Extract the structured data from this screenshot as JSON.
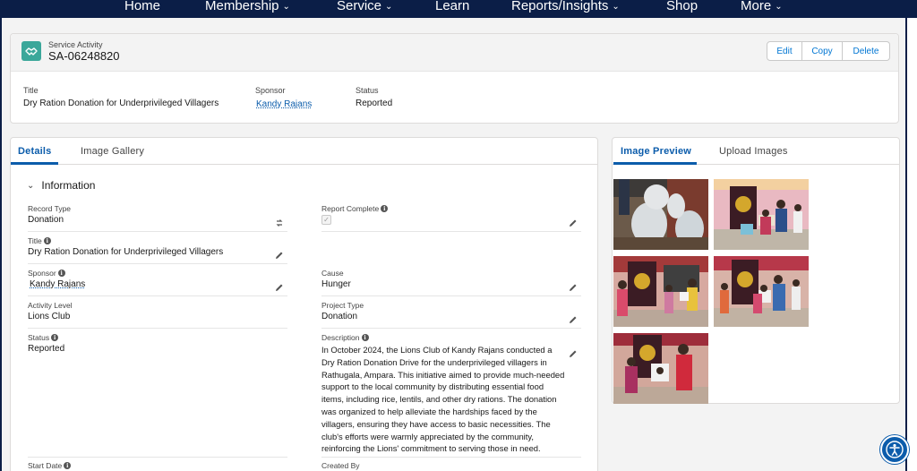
{
  "nav": {
    "home": "Home",
    "membership": "Membership",
    "service": "Service",
    "learn": "Learn",
    "reports": "Reports/Insights",
    "shop": "Shop",
    "more": "More"
  },
  "record": {
    "object_label": "Service Activity",
    "name": "SA-06248820",
    "actions": {
      "edit": "Edit",
      "copy": "Copy",
      "delete": "Delete"
    }
  },
  "highlights": {
    "title_label": "Title",
    "title_value": "Dry Ration Donation for Underprivileged Villagers",
    "sponsor_label": "Sponsor",
    "sponsor_value": "Kandy Rajans",
    "status_label": "Status",
    "status_value": "Reported"
  },
  "left_tabs": {
    "details": "Details",
    "gallery": "Image Gallery"
  },
  "section": {
    "title": "Information"
  },
  "fields": {
    "record_type_label": "Record Type",
    "record_type_value": "Donation",
    "title_label": "Title",
    "title_value": "Dry Ration Donation for Underprivileged Villagers",
    "sponsor_label": "Sponsor",
    "sponsor_value": "Kandy Rajans",
    "activity_level_label": "Activity Level",
    "activity_level_value": "Lions Club",
    "status_label": "Status",
    "status_value": "Reported",
    "start_date_label": "Start Date",
    "report_complete_label": "Report Complete",
    "report_complete_checked": true,
    "cause_label": "Cause",
    "cause_value": "Hunger",
    "project_type_label": "Project Type",
    "project_type_value": "Donation",
    "description_label": "Description",
    "description_value": "In October 2024, the Lions Club of Kandy Rajans conducted a Dry Ration Donation Drive for the underprivileged villagers in Rathugala, Ampara. This initiative aimed to provide much-needed support to the local community by distributing essential food items, including rice, lentils, and other dry rations. The donation was organized to help alleviate the hardships faced by the villagers, ensuring they have access to basic necessities. The club's efforts were warmly appreciated by the community, reinforcing the Lions' commitment to serving those in need.",
    "created_by_label": "Created By"
  },
  "right_tabs": {
    "preview": "Image Preview",
    "upload": "Upload Images"
  },
  "colors": {
    "nav_bg": "#0b1e47",
    "accent": "#0b5cab",
    "record_icon": "#3ba79a"
  }
}
